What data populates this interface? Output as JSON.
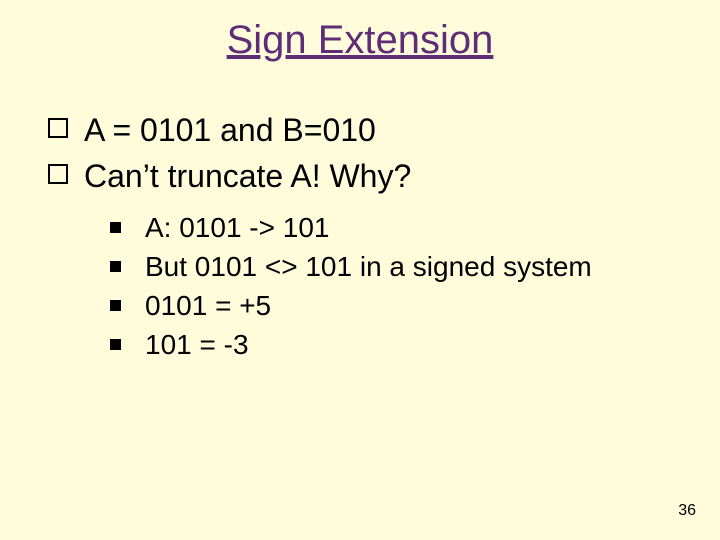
{
  "title": "Sign Extension",
  "bullets": [
    "A = 0101  and B=010",
    "Can’t truncate A! Why?"
  ],
  "sub_bullets": [
    "A:   0101 -> 101",
    "But 0101 <> 101 in a signed system",
    "0101 = +5",
    "101 = -3"
  ],
  "page_number": "36"
}
